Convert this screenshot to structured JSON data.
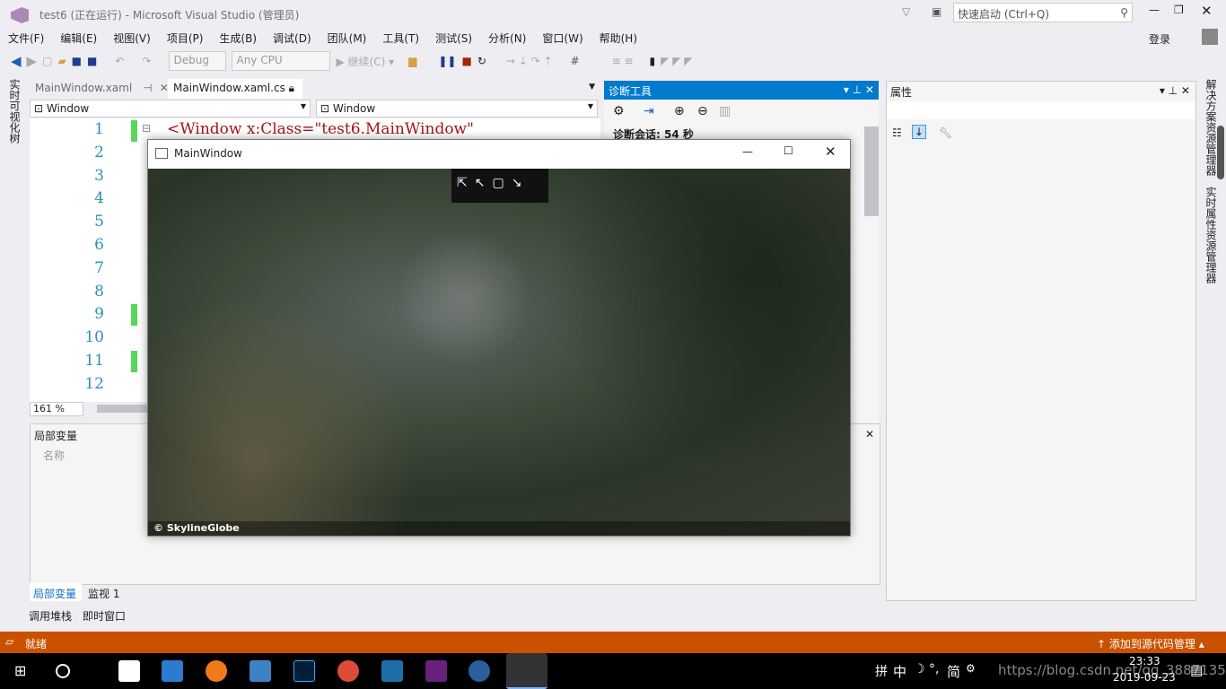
{
  "window": {
    "title": "test6 (正在运行) - Microsoft Visual Studio (管理员)",
    "quick_launch": "快速启动 (Ctrl+Q)",
    "login": "登录"
  },
  "menu": [
    "文件(F)",
    "编辑(E)",
    "视图(V)",
    "项目(P)",
    "生成(B)",
    "调试(D)",
    "团队(M)",
    "工具(T)",
    "测试(S)",
    "分析(N)",
    "窗口(W)",
    "帮助(H)"
  ],
  "toolbar": {
    "config": "Debug",
    "platform": "Any CPU",
    "continue": "继续(C)"
  },
  "left_rail": "实时可视化树",
  "editor": {
    "tabs": [
      "MainWindow.xaml",
      "MainWindow.xaml.cs"
    ],
    "nav_left": "Window",
    "nav_right": "Window",
    "line_numbers": [
      "1",
      "2",
      "3",
      "4",
      "5",
      "6",
      "7",
      "8",
      "9",
      "10",
      "11",
      "12"
    ],
    "line1": "<Window x:Class=\"test6.MainWindow\"",
    "zoom": "161 %"
  },
  "diag": {
    "title": "诊断工具",
    "session": "诊断会话: 54 秒"
  },
  "props": {
    "title": "属性"
  },
  "right_rail": [
    "解决方案资源管理器",
    "实时属性资源管理器"
  ],
  "locals": {
    "title": "局部变量",
    "column": "名称",
    "tabs": [
      "局部变量",
      "监视 1"
    ],
    "bottom_tabs": [
      "调用堆栈",
      "即时窗口"
    ]
  },
  "app_window": {
    "title": "MainWindow",
    "copyright": "© SkylineGlobe"
  },
  "status": {
    "text": "就绪",
    "source_control": "添加到源代码管理",
    "color": "#ca5100"
  },
  "taskbar": {
    "ime": [
      "拼",
      "中",
      "简"
    ],
    "time": "23:33",
    "date": "2019-09-23",
    "watermark": "https://blog.csdn.net/qq_38871352"
  }
}
